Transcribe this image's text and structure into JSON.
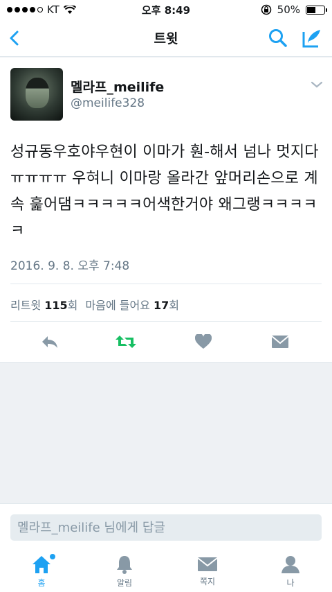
{
  "status_bar": {
    "carrier": "KT",
    "time": "오후 8:49",
    "battery": "50%",
    "battery_level": 0.5
  },
  "nav": {
    "title": "트윗"
  },
  "tweet": {
    "display_name": "멜라프_meilife",
    "screen_name": "@meilife328",
    "text": "성규동우호야우현이 이마가 훤-해서 넘나 멋지다ㅠㅠㅠㅠ 우혀니 이마랑 올라간 앞머리손으로 계속 훑어댐ㅋㅋㅋㅋㅋ어색한거야 왜그랭ㅋㅋㅋㅋㅋ",
    "timestamp": "2016. 9. 8. 오후 7:48",
    "retweet_label": "리트윗",
    "retweet_count": "115",
    "retweet_unit": "회",
    "like_label": "마음에 들어요",
    "like_count": "17",
    "like_unit": "회"
  },
  "reply": {
    "placeholder": "멜라프_meilife 님에게 답글"
  },
  "tabbar": {
    "items": [
      {
        "label": "홈",
        "icon": "home-icon"
      },
      {
        "label": "알림",
        "icon": "bell-icon"
      },
      {
        "label": "쪽지",
        "icon": "envelope-icon"
      },
      {
        "label": "나",
        "icon": "person-icon"
      }
    ]
  },
  "colors": {
    "accent": "#1da1f2",
    "retweet_green": "#17bf63",
    "gray": "#657786",
    "icon_gray": "#8899a6"
  }
}
